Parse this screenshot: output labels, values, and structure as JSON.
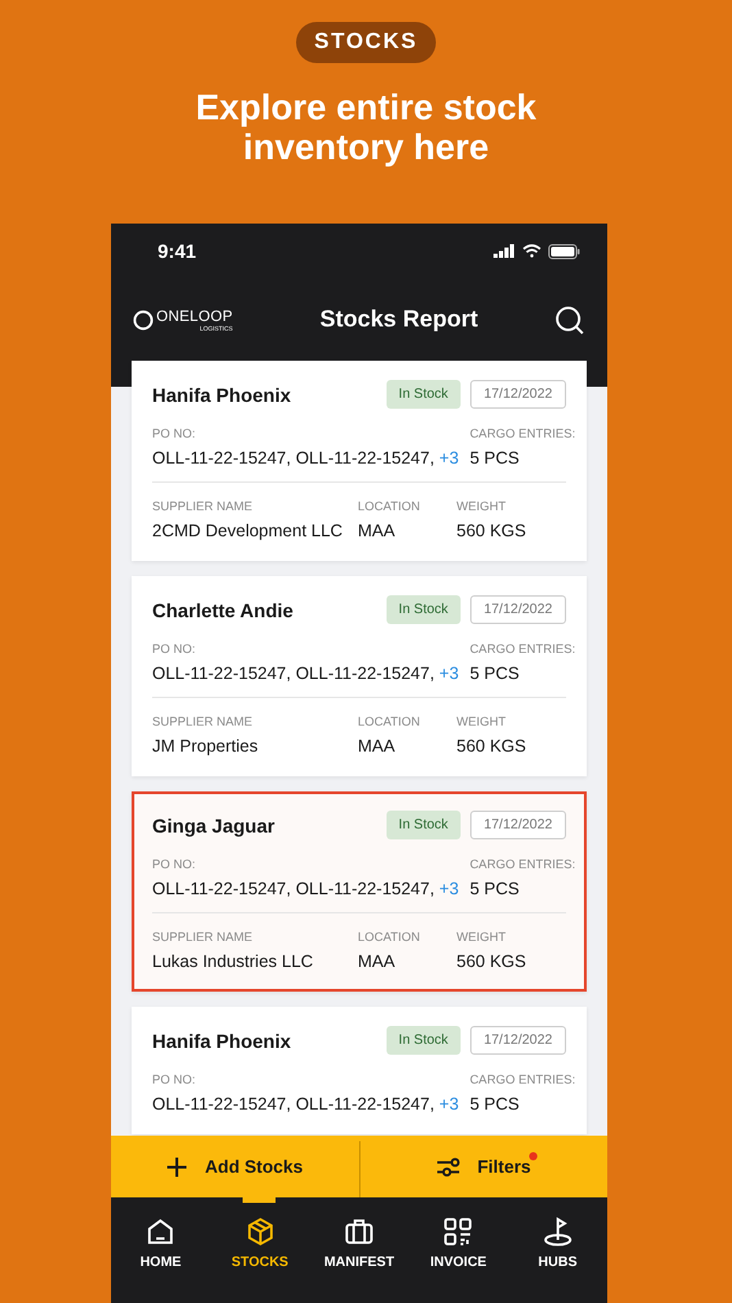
{
  "badge": "STOCKS",
  "headline": "Explore entire stock inventory here",
  "status_bar": {
    "time": "9:41"
  },
  "header": {
    "logo": {
      "name": "ONELOOP",
      "sub": "LOGISTICS"
    },
    "title": "Stocks Report"
  },
  "cards": [
    {
      "name": "Hanifa Phoenix",
      "status": "In Stock",
      "date": "17/12/2022",
      "selected": false,
      "po_label": "PO NO:",
      "po": "OLL-11-22-15247, OLL-11-22-15247,",
      "po_more": "+3",
      "cargo_label": "CARGO ENTRIES:",
      "cargo": "5 PCS",
      "supplier_label": "SUPPLIER NAME",
      "supplier": "2CMD Development LLC",
      "location_label": "LOCATION",
      "location": "MAA",
      "weight_label": "WEIGHT",
      "weight": "560 KGS"
    },
    {
      "name": "Charlette Andie",
      "status": "In Stock",
      "date": "17/12/2022",
      "selected": false,
      "po_label": "PO NO:",
      "po": "OLL-11-22-15247, OLL-11-22-15247,",
      "po_more": "+3",
      "cargo_label": "CARGO ENTRIES:",
      "cargo": "5 PCS",
      "supplier_label": "SUPPLIER NAME",
      "supplier": "JM Properties",
      "location_label": "LOCATION",
      "location": "MAA",
      "weight_label": "WEIGHT",
      "weight": "560 KGS"
    },
    {
      "name": "Ginga Jaguar",
      "status": "In Stock",
      "date": "17/12/2022",
      "selected": true,
      "po_label": "PO NO:",
      "po": "OLL-11-22-15247, OLL-11-22-15247,",
      "po_more": "+3",
      "cargo_label": "CARGO ENTRIES:",
      "cargo": "5 PCS",
      "supplier_label": "SUPPLIER NAME",
      "supplier": "Lukas Industries LLC",
      "location_label": "LOCATION",
      "location": "MAA",
      "weight_label": "WEIGHT",
      "weight": "560 KGS"
    },
    {
      "name": "Hanifa Phoenix",
      "status": "In Stock",
      "date": "17/12/2022",
      "selected": false,
      "po_label": "PO NO:",
      "po": "OLL-11-22-15247, OLL-11-22-15247,",
      "po_more": "+3",
      "cargo_label": "CARGO ENTRIES:",
      "cargo": "5 PCS"
    }
  ],
  "actions": {
    "add": {
      "label": "Add Stocks"
    },
    "filters": {
      "label": "Filters",
      "active": true
    }
  },
  "nav": [
    {
      "kind": "home",
      "label": "HOME",
      "selected": false
    },
    {
      "kind": "box",
      "label": "STOCKS",
      "selected": true
    },
    {
      "kind": "briefcase",
      "label": "MANIFEST",
      "selected": false
    },
    {
      "kind": "grid",
      "label": "INVOICE",
      "selected": false
    },
    {
      "kind": "flag",
      "label": "HUBS",
      "selected": false
    }
  ]
}
